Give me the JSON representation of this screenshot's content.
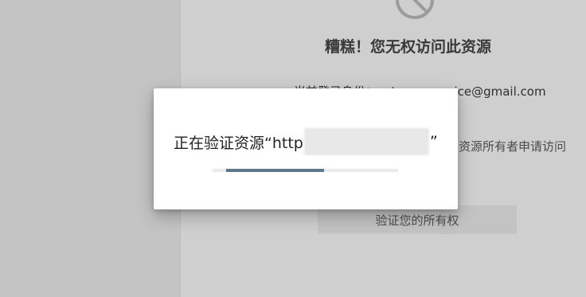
{
  "background": {
    "title": "糟糕！您无权访问此资源",
    "account_line": "当前登录身份：pstuwm.service@gmail.com",
    "account_line_2": "om",
    "request_line": "者向资源所有者申请访问",
    "verify_button_label": "验证您的所有权"
  },
  "dialog": {
    "message_prefix": "正在验证资源“http",
    "message_suffix": "”",
    "progress_fraction": 0.57
  },
  "icons": {
    "forbidden": "forbidden-icon"
  }
}
